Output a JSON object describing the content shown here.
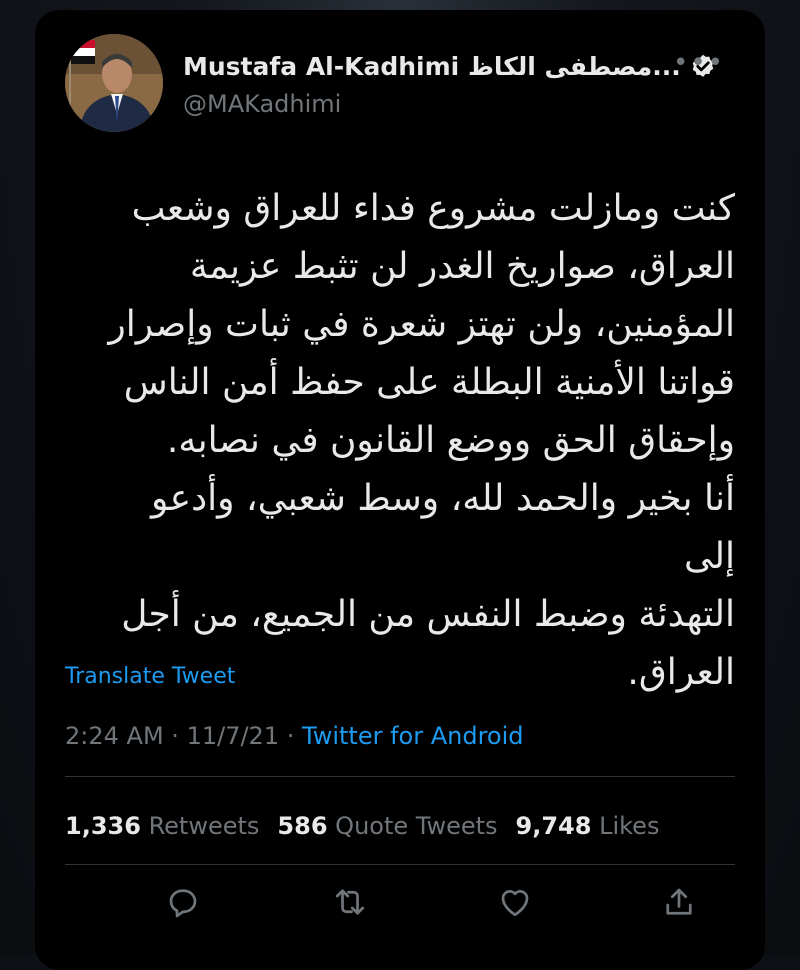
{
  "tweet": {
    "author": {
      "display_name": "Mustafa Al-Kadhimi مصطفى الكاظ...",
      "handle": "@MAKadhimi",
      "verified": true
    },
    "text": "كنت ومازلت مشروع فداء للعراق وشعب\nالعراق، صواريخ الغدر لن تثبط عزيمة\nالمؤمنين، ولن تهتز شعرة في ثبات وإصرار\nقواتنا الأمنية البطلة على حفظ أمن الناس\nوإحقاق الحق ووضع القانون في نصابه.\nأنا بخير والحمد لله، وسط شعبي، وأدعو إلى\nالتهدئة وضبط النفس من الجميع، من أجل\nالعراق.",
    "translate_label": "Translate Tweet",
    "time": "2:24 AM",
    "date": "11/7/21",
    "separator": "·",
    "source": "Twitter for Android",
    "stats": {
      "retweets_count": "1,336",
      "retweets_label": "Retweets",
      "quotes_count": "586",
      "quotes_label": "Quote Tweets",
      "likes_count": "9,748",
      "likes_label": "Likes"
    },
    "actions": [
      {
        "icon": "reply-icon"
      },
      {
        "icon": "retweet-icon"
      },
      {
        "icon": "like-icon"
      },
      {
        "icon": "share-icon"
      }
    ]
  },
  "colors": {
    "background": "#000000",
    "text": "#e7e9ea",
    "muted": "#71767b",
    "accent": "#1d9bf0",
    "divider": "#2f3336"
  }
}
